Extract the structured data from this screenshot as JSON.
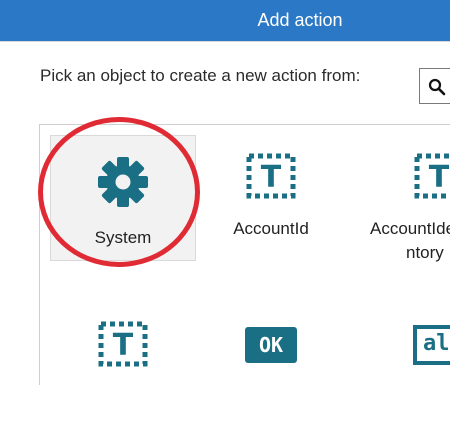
{
  "dialog": {
    "title": "Add action",
    "prompt": "Pick an object to create a new action from:",
    "search_icon": "search-icon",
    "accent_color": "#2b78c6",
    "icon_color": "#1a6f84",
    "highlight_color": "#e02a34"
  },
  "objects": [
    {
      "label": "System",
      "icon": "gear-icon",
      "selected": true
    },
    {
      "label": "AccountId",
      "icon": "text-field-icon"
    },
    {
      "label": "AccountIdentory",
      "label_line1": "AccountIde",
      "label_line2": "ntory",
      "icon": "text-field-icon"
    },
    {
      "label": "",
      "icon": "text-field-icon"
    },
    {
      "label": "",
      "icon": "ok-button-icon",
      "icon_text": "OK"
    },
    {
      "label": "",
      "icon": "label-icon",
      "icon_text": "al"
    }
  ]
}
